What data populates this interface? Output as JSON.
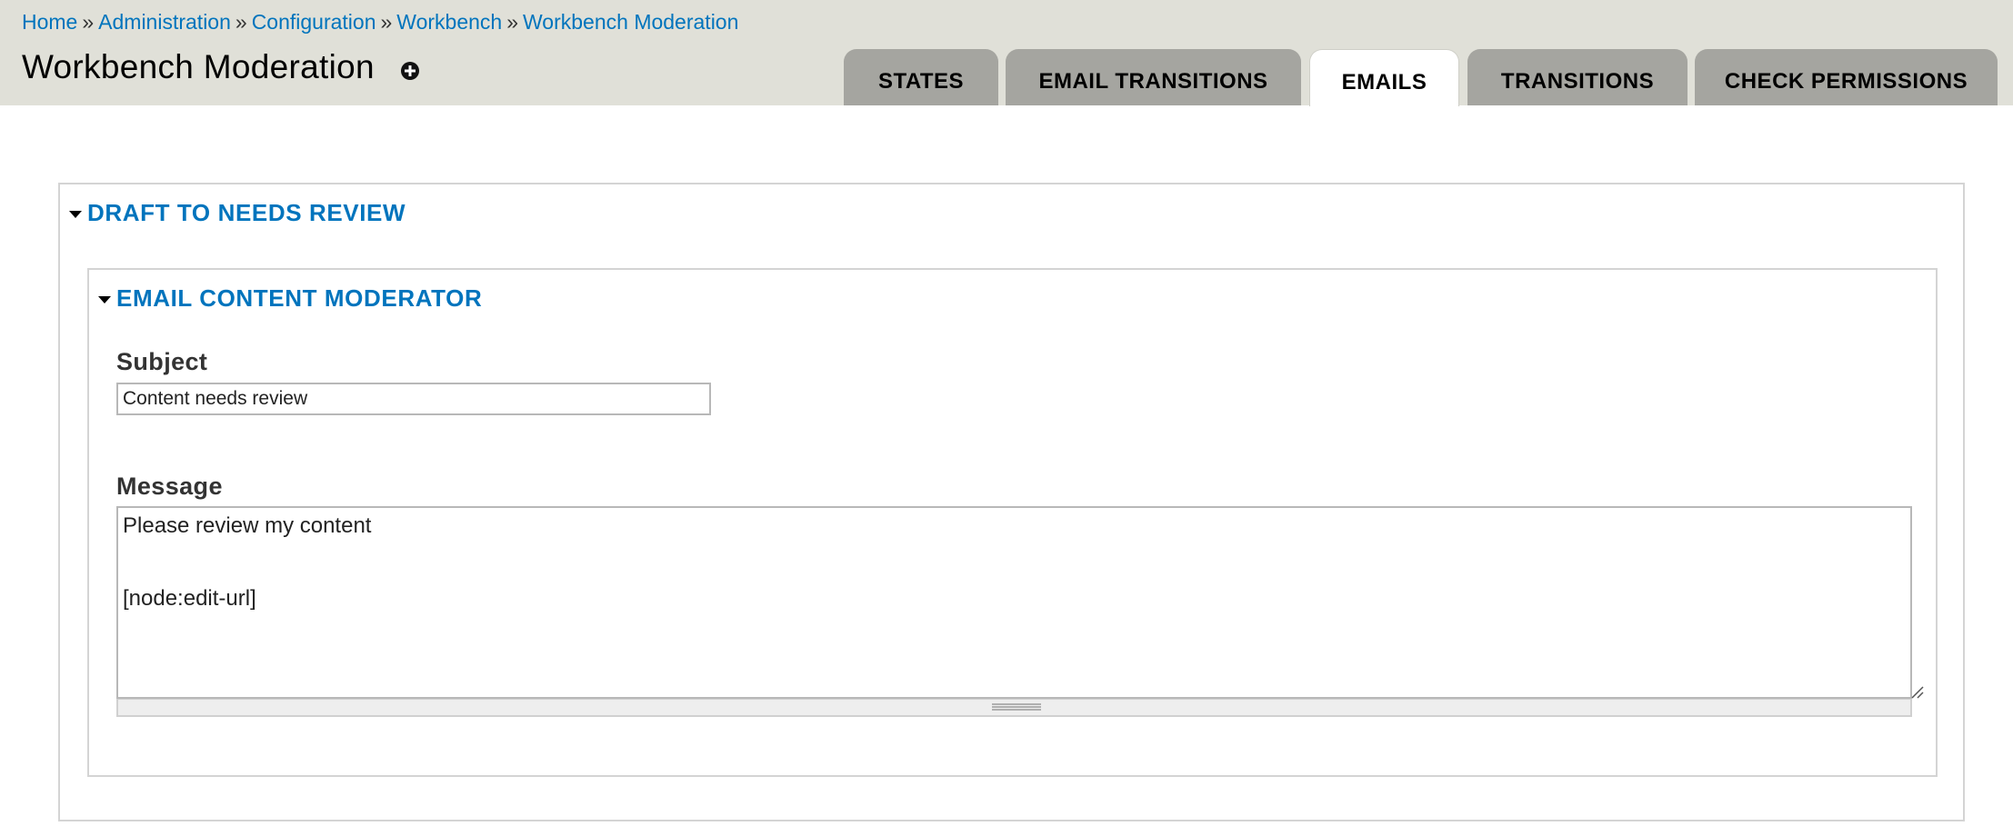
{
  "breadcrumb": {
    "items": [
      "Home",
      "Administration",
      "Configuration",
      "Workbench",
      "Workbench Moderation"
    ],
    "separator": "»"
  },
  "page": {
    "title": "Workbench Moderation",
    "shortcut_icon": "plus-circle-icon"
  },
  "tabs": [
    {
      "label": "STATES",
      "active": false
    },
    {
      "label": "EMAIL TRANSITIONS",
      "active": false
    },
    {
      "label": "EMAILS",
      "active": true
    },
    {
      "label": "TRANSITIONS",
      "active": false
    },
    {
      "label": "CHECK PERMISSIONS",
      "active": false
    }
  ],
  "transition_fieldset": {
    "legend": "DRAFT TO NEEDS REVIEW",
    "email_fieldset": {
      "legend": "EMAIL CONTENT MODERATOR",
      "subject": {
        "label": "Subject",
        "value": "Content needs review"
      },
      "message": {
        "label": "Message",
        "value": "Please review my content\n\n[node:edit-url]"
      }
    }
  },
  "colors": {
    "link": "#0074bd",
    "header_bg": "#e0e0d8",
    "tab_inactive_bg": "#a5a5a0",
    "tab_active_bg": "#ffffff"
  }
}
